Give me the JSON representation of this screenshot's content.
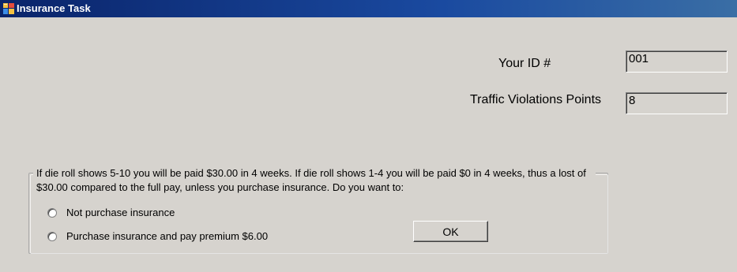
{
  "window": {
    "title": "Insurance Task",
    "icon": "app-window-icon"
  },
  "form": {
    "id_label": "Your ID #",
    "id_value": "001",
    "points_label": "Traffic Violations Points",
    "points_value": "8"
  },
  "group": {
    "prompt": "If die roll shows 5-10 you will be paid $30.00 in 4 weeks. If die roll shows 1-4 you will be paid $0 in 4 weeks, thus a lost of $30.00 compared to the full pay, unless you purchase insurance. Do you want to:",
    "options": [
      {
        "label": "Not purchase insurance",
        "selected": false
      },
      {
        "label": "Purchase insurance and pay premium $6.00",
        "selected": false
      }
    ],
    "ok_label": "OK"
  },
  "colors": {
    "title_bar": "#0a246a",
    "window_bg": "#d6d3ce"
  }
}
